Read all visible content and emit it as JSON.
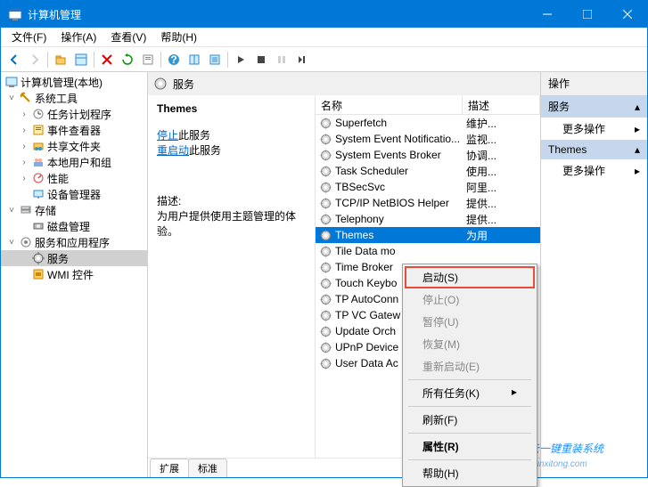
{
  "window": {
    "title": "计算机管理"
  },
  "menu": {
    "file": "文件(F)",
    "action": "操作(A)",
    "view": "查看(V)",
    "help": "帮助(H)"
  },
  "tree": {
    "root": "计算机管理(本地)",
    "systools": "系统工具",
    "taskscheduler": "任务计划程序",
    "eventviewer": "事件查看器",
    "sharedfolders": "共享文件夹",
    "localusers": "本地用户和组",
    "performance": "性能",
    "devicemgr": "设备管理器",
    "storage": "存储",
    "diskmgmt": "磁盘管理",
    "servicesapps": "服务和应用程序",
    "services": "服务",
    "wmi": "WMI 控件"
  },
  "center": {
    "header": "服务",
    "selected_name": "Themes",
    "stop_link": "停止",
    "stop_suffix": "此服务",
    "restart_link": "重启动",
    "restart_suffix": "此服务",
    "desc_label": "描述:",
    "desc_text": "为用户提供使用主题管理的体验。",
    "col_name": "名称",
    "col_desc": "描述",
    "services": [
      {
        "name": "Superfetch",
        "desc": "维护..."
      },
      {
        "name": "System Event Notificatio...",
        "desc": "监视..."
      },
      {
        "name": "System Events Broker",
        "desc": "协调..."
      },
      {
        "name": "Task Scheduler",
        "desc": "使用..."
      },
      {
        "name": "TBSecSvc",
        "desc": "阿里..."
      },
      {
        "name": "TCP/IP NetBIOS Helper",
        "desc": "提供..."
      },
      {
        "name": "Telephony",
        "desc": "提供..."
      },
      {
        "name": "Themes",
        "desc": "为用",
        "selected": true
      },
      {
        "name": "Tile Data mo",
        "desc": ""
      },
      {
        "name": "Time Broker",
        "desc": ""
      },
      {
        "name": "Touch Keybo",
        "desc": ""
      },
      {
        "name": "TP AutoConn",
        "desc": ""
      },
      {
        "name": "TP VC Gatew",
        "desc": ""
      },
      {
        "name": "Update Orch",
        "desc": ""
      },
      {
        "name": "UPnP Device",
        "desc": ""
      },
      {
        "name": "User Data Ac",
        "desc": ""
      }
    ],
    "tab_extended": "扩展",
    "tab_standard": "标准"
  },
  "actions": {
    "header": "操作",
    "services": "服务",
    "more1": "更多操作",
    "themes": "Themes",
    "more2": "更多操作"
  },
  "context": {
    "start": "启动(S)",
    "stop": "停止(O)",
    "pause": "暂停(U)",
    "resume": "恢复(M)",
    "restart": "重新启动(E)",
    "alltasks": "所有任务(K)",
    "refresh": "刷新(F)",
    "properties": "属性(R)",
    "help": "帮助(H)"
  },
  "watermark": "白云一键重装系统",
  "watermark_url": "baiyunxitong.com"
}
